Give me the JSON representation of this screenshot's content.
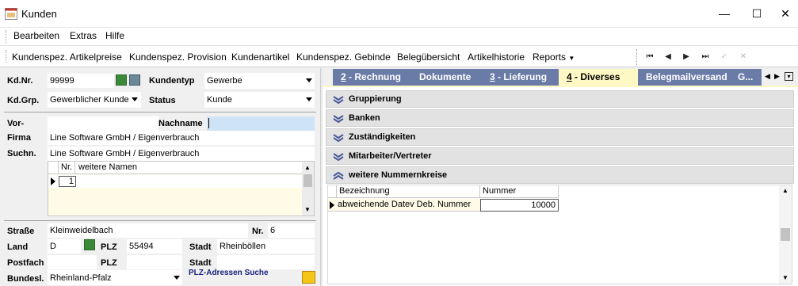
{
  "window": {
    "title": "Kunden"
  },
  "menu": {
    "items": [
      "Bearbeiten",
      "Extras",
      "Hilfe"
    ]
  },
  "toolbar": {
    "items": [
      "Kundenspez. Artikelpreise",
      "Kundenspez. Provision",
      "Kundenartikel",
      "Kundenspez. Gebinde",
      "Belegübersicht",
      "Artikelhistorie"
    ],
    "reports_label": "Reports"
  },
  "customer": {
    "kdnr_label": "Kd.Nr.",
    "kdnr_value": "99999",
    "kundentyp_label": "Kundentyp",
    "kundentyp_value": "Gewerbe",
    "kdgrp_label": "Kd.Grp.",
    "kdgrp_value": "Gewerblicher Kunde",
    "status_label": "Status",
    "status_value": "Kunde",
    "vor_label": "Vor-",
    "vor_value": "",
    "nachname_label": "Nachname",
    "nachname_value": "",
    "firma_label": "Firma",
    "firma_value": "Line Software GmbH / Eigenverbrauch",
    "suchn_label": "Suchn.",
    "suchn_value": "Line Software GmbH / Eigenverbrauch"
  },
  "names_grid": {
    "col_nr": "Nr.",
    "col_names": "weitere Namen",
    "rows": [
      {
        "nr": "1",
        "name": ""
      }
    ]
  },
  "address": {
    "strasse_label": "Straße",
    "strasse_value": "Kleinweidelbach",
    "nr_label": "Nr.",
    "nr_value": "6",
    "land_label": "Land",
    "land_value": "D",
    "plz_label": "PLZ",
    "plz_value": "55494",
    "stadt_label": "Stadt",
    "stadt_value": "Rheinböllen",
    "postfach_label": "Postfach",
    "postfach_value": "",
    "plz2_label": "PLZ",
    "plz2_value": "",
    "stadt2_label": "Stadt",
    "stadt2_value": "",
    "bundesl_label": "Bundesl.",
    "bundesl_value": "Rheinland-Pfalz",
    "plz_search_link": "PLZ-Adressen Suche"
  },
  "tabs": [
    {
      "num": "2",
      "label": " - Rechnung"
    },
    {
      "num": "",
      "label": "Dokumente"
    },
    {
      "num": "3",
      "label": " - Lieferung"
    },
    {
      "num": "4",
      "label": " - Diverses"
    },
    {
      "num": "",
      "label": "Belegmailversand"
    },
    {
      "num": "",
      "label": "G..."
    }
  ],
  "active_tab_index": 3,
  "sections": [
    "Gruppierung",
    "Banken",
    "Zuständigkeiten",
    "Mitarbeiter/Vertreter",
    "weitere Nummernkreise"
  ],
  "nummernkreise_grid": {
    "col_bezeichnung": "Bezeichnung",
    "col_nummer": "Nummer",
    "rows": [
      {
        "bezeichnung": "abweichende Datev Deb. Nummer",
        "nummer": "10000"
      }
    ]
  },
  "colors": {
    "tab_bg": "#6b7ba8",
    "tab_active_bg": "#fff7c4",
    "highlight_field": "#cfe3f7",
    "chevron": "#4a5a9a",
    "link": "#1a237e"
  },
  "icons": [
    "app-icon",
    "minimize-icon",
    "maximize-icon",
    "close-icon",
    "first-record-icon",
    "prev-record-icon",
    "next-record-icon",
    "last-record-icon",
    "confirm-icon",
    "cancel-icon"
  ]
}
